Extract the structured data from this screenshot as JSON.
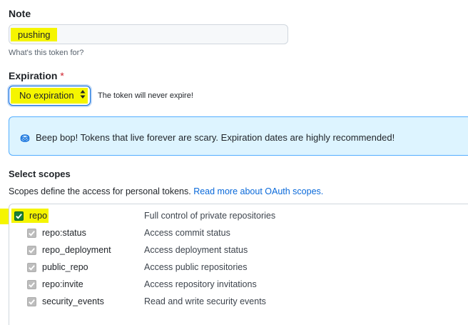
{
  "note": {
    "label": "Note",
    "value": "pushing",
    "hint": "What's this token for?"
  },
  "expiration": {
    "label": "Expiration",
    "required_mark": "*",
    "selected": "No expiration",
    "message": "The token will never expire!"
  },
  "flash": {
    "icon": "copilot-icon",
    "text": "Beep bop! Tokens that live forever are scary. Expiration dates are highly recommended!"
  },
  "scopes": {
    "title": "Select scopes",
    "description": "Scopes define the access for personal tokens.",
    "link_text": "Read more about OAuth scopes.",
    "items": [
      {
        "name": "repo",
        "description": "Full control of private repositories",
        "checked": true
      },
      {
        "name": "repo:status",
        "description": "Access commit status",
        "checked": true
      },
      {
        "name": "repo_deployment",
        "description": "Access deployment status",
        "checked": true
      },
      {
        "name": "public_repo",
        "description": "Access public repositories",
        "checked": true
      },
      {
        "name": "repo:invite",
        "description": "Access repository invitations",
        "checked": true
      },
      {
        "name": "security_events",
        "description": "Read and write security events",
        "checked": true
      }
    ]
  },
  "colors": {
    "highlight": "#f5f500",
    "accent": "#0969da",
    "checkbox_checked": "#1a7f37",
    "flash_bg": "#ddf4ff"
  }
}
